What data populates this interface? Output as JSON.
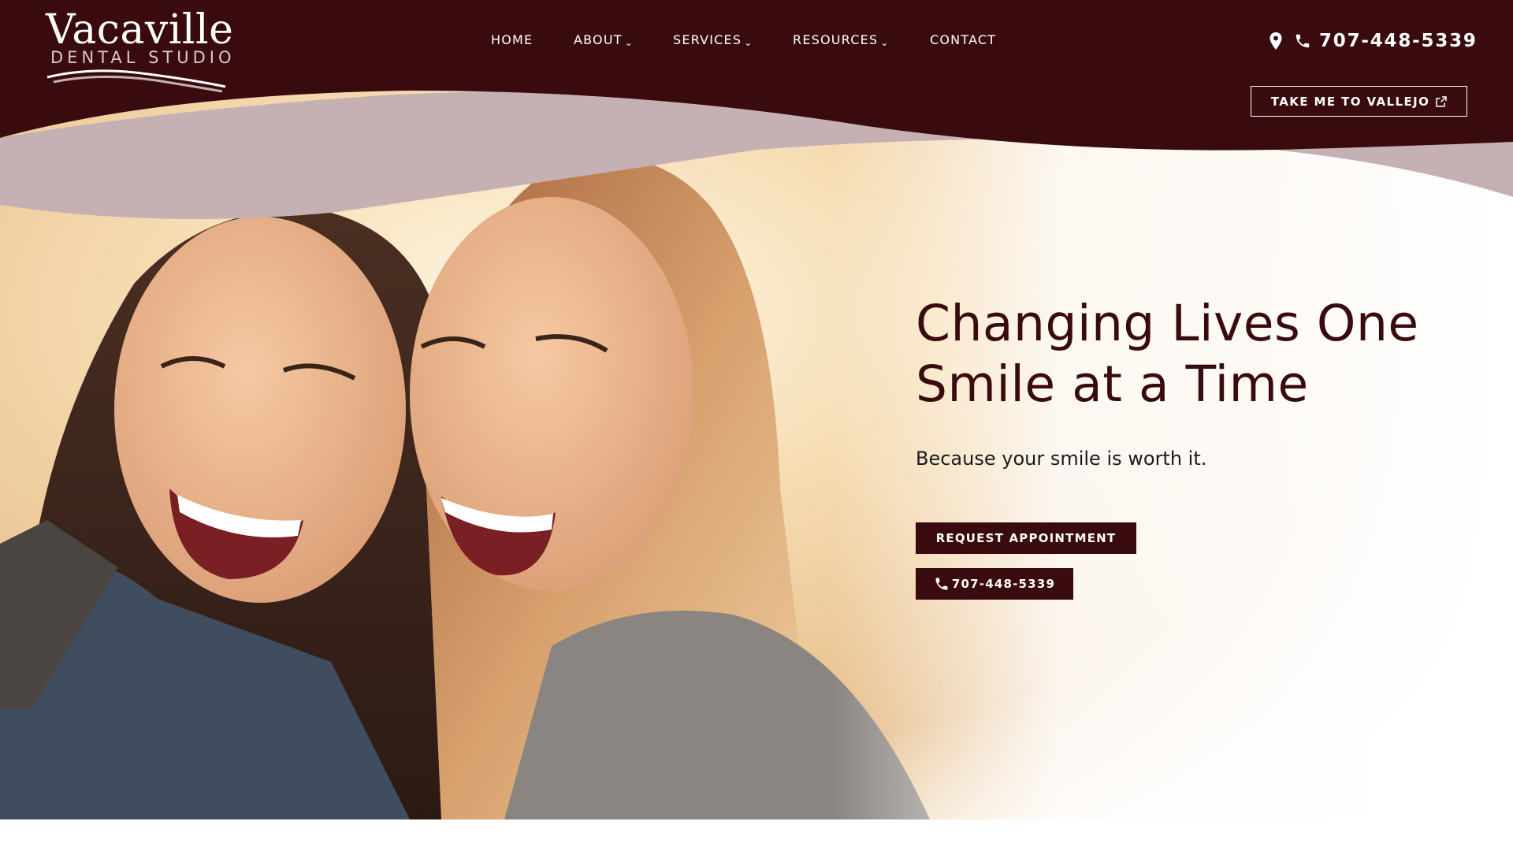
{
  "page": {
    "colors": {
      "brand_maroon": "#3a0b0e",
      "wave_mauve": "#c5b0b4",
      "white": "#ffffff"
    }
  },
  "header": {
    "logo": {
      "main": "Vacaville",
      "sub": "DENTAL STUDIO"
    },
    "nav": {
      "items": [
        {
          "label": "HOME",
          "has_dropdown": false
        },
        {
          "label": "ABOUT",
          "has_dropdown": true
        },
        {
          "label": "SERVICES",
          "has_dropdown": true
        },
        {
          "label": "RESOURCES",
          "has_dropdown": true
        },
        {
          "label": "CONTACT",
          "has_dropdown": false
        }
      ],
      "dropdown_icon": "chevron-down-icon"
    },
    "phone": {
      "number": "707-448-5339",
      "icons": [
        "map-pin-icon",
        "phone-icon"
      ]
    },
    "vallejo_button": {
      "label": "TAKE ME TO VALLEJO",
      "icon": "external-link-icon"
    }
  },
  "hero": {
    "title": "Changing Lives One Smile at a Time",
    "subtitle": "Because your smile is worth it.",
    "cta_appointment": "REQUEST APPOINTMENT",
    "cta_phone": "707-448-5339",
    "cta_phone_icon": "phone-icon",
    "image": "two-smiling-women-selfie-photo"
  }
}
